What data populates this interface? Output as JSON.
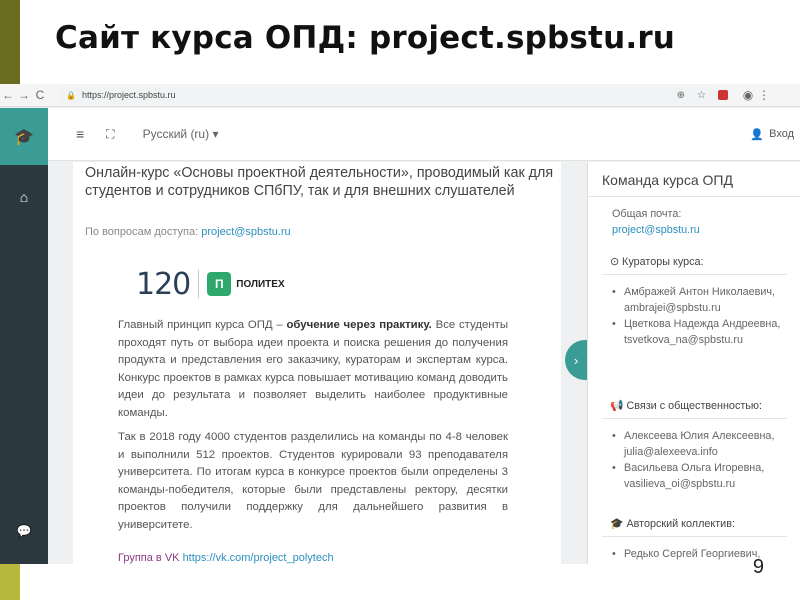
{
  "slide": {
    "title": "Сайт курса ОПД: project.spbstu.ru",
    "page_number": "9"
  },
  "browser": {
    "url": "https://project.spbstu.ru",
    "nav": [
      "←",
      "→",
      "C"
    ]
  },
  "app": {
    "language": "Русский (ru)",
    "login": "Вход"
  },
  "content": {
    "heading": "Онлайн-курс «Основы проектной деятельности», проводимый как для студентов и сотрудников СПбПУ, так и для внешних слушателей",
    "access_label": "По вопросам доступа:",
    "access_email": "project@spbstu.ru",
    "logo_number": "120",
    "logo_text": "ПОЛИТЕХ",
    "para1_a": "Главный принцип курса ОПД – ",
    "para1_b": "обучение через практику.",
    "para1_c": " Все студенты проходят путь от выбора идеи проекта и поиска решения до получения продукта и представления его заказчику, кураторам и экспертам курса. Конкурс проектов в рамках курса повышает мотивацию команд доводить идеи до результата и позволяет выделить наиболее продуктивные команды.",
    "para2": "Так в 2018 году 4000 студентов разделились на команды по 4-8 человек и выполнили 512 проектов. Студентов курировали 93 преподавателя университета. По итогам курса в конкурсе проектов были определены 3 команды-победителя, которые были представлены ректору, десятки проектов получили поддержку для дальнейшего развития в университете.",
    "vk_label": "Группа в VK",
    "vk_link": "https://vk.com/project_polytech"
  },
  "team": {
    "title": "Команда курса ОПД",
    "general_mail_label": "Общая почта:",
    "general_mail": "project@spbstu.ru",
    "curators_label": "Кураторы курса:",
    "curators": [
      {
        "name": "Амбражей Антон Николаевич,",
        "email": "ambrajei@spbstu.ru"
      },
      {
        "name": "Цветкова Надежда Андреевна,",
        "email": "tsvetkova_na@spbstu.ru"
      }
    ],
    "pr_label": "Связи с общественностью:",
    "pr": [
      {
        "name": "Алексеева Юлия Алексеевна,",
        "email": "julia@alexeeva.info"
      },
      {
        "name": "Васильева Ольга Игоревна,",
        "email": "vasilieva_oi@spbstu.ru"
      }
    ],
    "authors_label": "Авторский коллектив:",
    "authors": [
      "Редько Сергей Георгиевич,"
    ]
  },
  "colors": {
    "accent": "#3a9c95",
    "sidebar": "#2b3840",
    "link": "#2b8fbf",
    "olive_top": "#6b6b1f",
    "olive_bottom": "#b5b83a"
  }
}
